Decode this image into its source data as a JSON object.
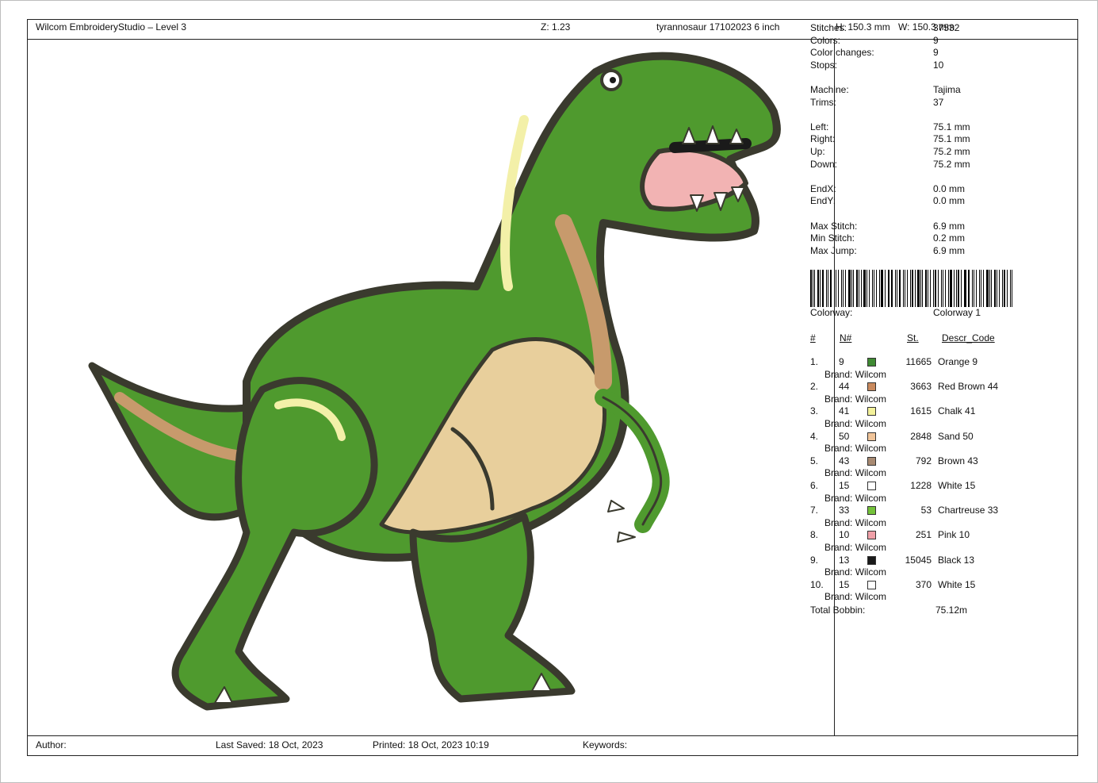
{
  "header": {
    "app": "Wilcom EmbroideryStudio – Level 3",
    "zoom": "Z: 1.23",
    "design_name": "tyrannosaur 17102023 6 inch",
    "height": "H: 150.3 mm",
    "width": "W: 150.3 mm"
  },
  "stats": [
    {
      "k": "Stitches:",
      "v": "37532"
    },
    {
      "k": "Colors:",
      "v": "9"
    },
    {
      "k": "Color changes:",
      "v": "9"
    },
    {
      "k": "Stops:",
      "v": "10"
    },
    null,
    {
      "k": "Machine:",
      "v": "Tajima"
    },
    {
      "k": "Trims:",
      "v": "37"
    },
    null,
    {
      "k": "Left:",
      "v": "75.1 mm"
    },
    {
      "k": "Right:",
      "v": "75.1 mm"
    },
    {
      "k": "Up:",
      "v": "75.2 mm"
    },
    {
      "k": "Down:",
      "v": "75.2 mm"
    },
    null,
    {
      "k": "EndX:",
      "v": "0.0 mm"
    },
    {
      "k": "EndY:",
      "v": "0.0 mm"
    },
    null,
    {
      "k": "Max Stitch:",
      "v": "6.9 mm"
    },
    {
      "k": "Min Stitch:",
      "v": "0.2 mm"
    },
    {
      "k": "Max Jump:",
      "v": "6.9 mm"
    }
  ],
  "colorway": {
    "label": "Colorway:",
    "value": "Colorway 1"
  },
  "color_table": {
    "headers": {
      "idx": "#",
      "num": "N#",
      "st": "St.",
      "desc": "Descr_Code"
    },
    "brand_label": "Brand: Wilcom",
    "rows": [
      {
        "idx": "1.",
        "num": "9",
        "color": "#3f8a33",
        "st": "11665",
        "desc": "Orange 9"
      },
      {
        "idx": "2.",
        "num": "44",
        "color": "#c98a5e",
        "st": "3663",
        "desc": "Red Brown 44"
      },
      {
        "idx": "3.",
        "num": "41",
        "color": "#f3f19a",
        "st": "1615",
        "desc": "Chalk 41"
      },
      {
        "idx": "4.",
        "num": "50",
        "color": "#f0c499",
        "st": "2848",
        "desc": "Sand 50"
      },
      {
        "idx": "5.",
        "num": "43",
        "color": "#a88a72",
        "st": "792",
        "desc": "Brown 43"
      },
      {
        "idx": "6.",
        "num": "15",
        "color": "#ffffff",
        "st": "1228",
        "desc": "White 15"
      },
      {
        "idx": "7.",
        "num": "33",
        "color": "#74c23a",
        "st": "53",
        "desc": "Chartreuse 33"
      },
      {
        "idx": "8.",
        "num": "10",
        "color": "#f0a0a8",
        "st": "251",
        "desc": "Pink 10"
      },
      {
        "idx": "9.",
        "num": "13",
        "color": "#1a1a1a",
        "st": "15045",
        "desc": "Black 13"
      },
      {
        "idx": "10.",
        "num": "15",
        "color": "#ffffff",
        "st": "370",
        "desc": "White 15"
      }
    ],
    "total_label": "Total Bobbin:",
    "total_value": "75.12m"
  },
  "footer": {
    "author": "Author:",
    "saved": "Last Saved: 18 Oct, 2023",
    "printed": "Printed: 18 Oct, 2023 10:19",
    "keywords": "Keywords:"
  },
  "design_colors": {
    "green": "#4f9a2e",
    "dark": "#3a3a2e",
    "tan": "#c79a6c",
    "cream": "#f3f0a8",
    "belly": "#e8cf9c",
    "pink": "#f2b3b3"
  }
}
